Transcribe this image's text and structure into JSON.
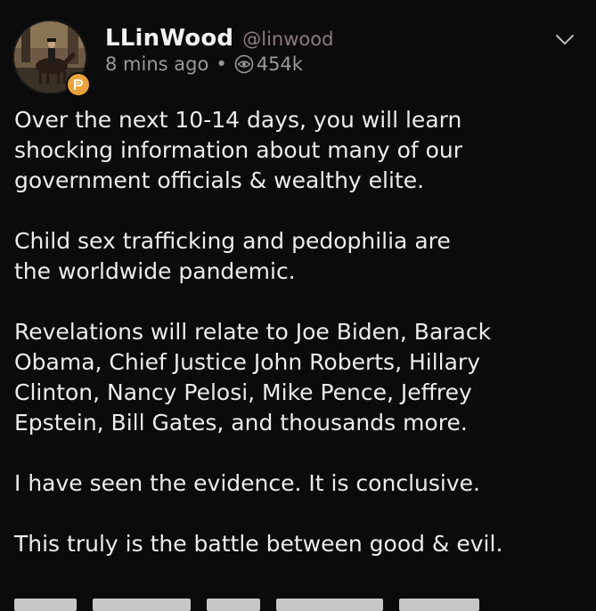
{
  "post": {
    "author": {
      "display_name": "LLinWood",
      "handle": "@linwood",
      "avatar_icon": "avatar-photo-rider-on-horse",
      "badge_icon": "parler-p-badge-icon"
    },
    "meta": {
      "time_ago": "8 mins ago",
      "separator": "•",
      "views_icon": "eye-icon",
      "views": "454k"
    },
    "menu_icon": "chevron-down-icon",
    "paragraphs": [
      "Over the next 10-14 days, you will learn\nshocking information about many of our\ngovernment officials & wealthy elite.",
      "Child sex trafficking and pedophilia are\nthe worldwide pandemic.",
      "Revelations will relate to Joe Biden, Barack\nObama, Chief Justice John Roberts, Hillary\nClinton, Nancy Pelosi, Mike Pence, Jeffrey\nEpstein, Bill Gates, and thousands more.",
      "I have seen the evidence. It is conclusive.",
      "This truly is the battle between good & evil."
    ]
  },
  "colors": {
    "background": "#0b0b0b",
    "text": "#ececec",
    "handle": "#8c7a86",
    "meta": "#9a9a9a",
    "badge": "#e8a33a"
  }
}
